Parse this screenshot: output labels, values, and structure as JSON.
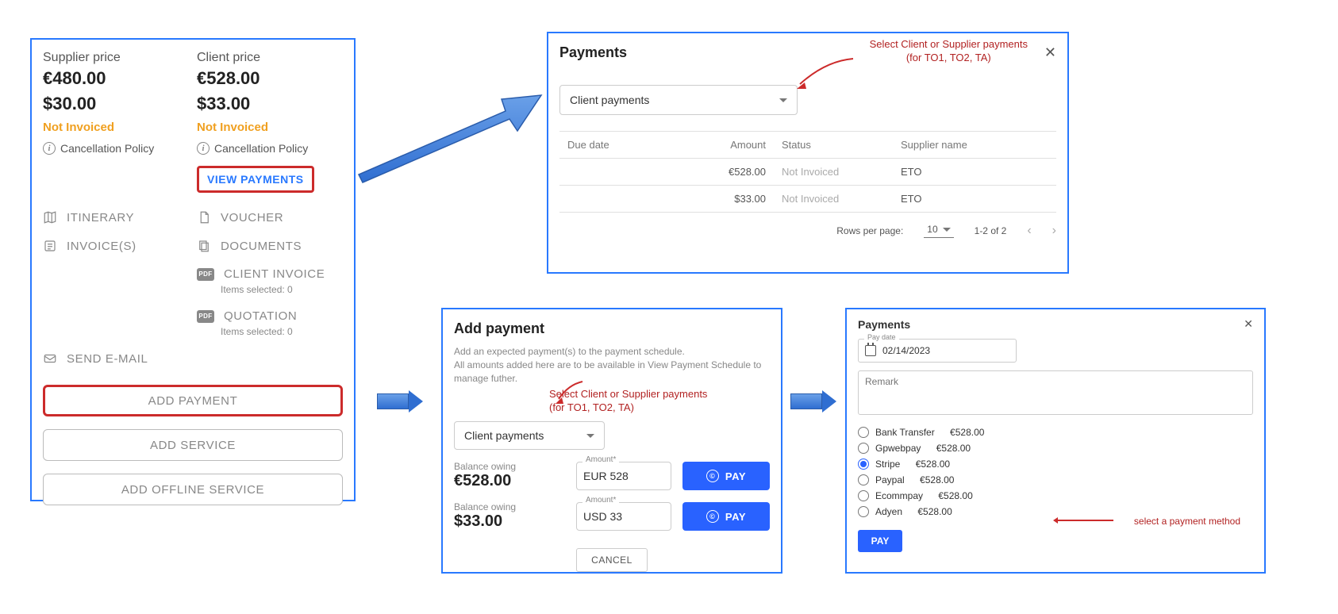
{
  "panel1": {
    "supplier_label": "Supplier price",
    "client_label": "Client price",
    "supplier_price_eur": "€480.00",
    "supplier_price_usd": "$30.00",
    "client_price_eur": "€528.00",
    "client_price_usd": "$33.00",
    "supplier_status": "Not Invoiced",
    "client_status": "Not Invoiced",
    "cancel_policy": "Cancellation Policy",
    "view_payments": "VIEW PAYMENTS",
    "links": {
      "itinerary": "ITINERARY",
      "invoices": "INVOICE(S)",
      "voucher": "VOUCHER",
      "documents": "DOCUMENTS",
      "client_invoice": "CLIENT INVOICE",
      "client_invoice_sub": "Items selected: 0",
      "quotation": "QUOTATION",
      "quotation_sub": "Items selected: 0",
      "send_email": "SEND E-MAIL"
    },
    "add_payment": "ADD PAYMENT",
    "add_service": "ADD SERVICE",
    "add_offline_service": "ADD OFFLINE SERVICE"
  },
  "panel2": {
    "title": "Payments",
    "annotation_l1": "Select Client or Supplier payments",
    "annotation_l2": "(for TO1, TO2, TA)",
    "select_label": "Client payments",
    "head": {
      "due": "Due date",
      "amount": "Amount",
      "status": "Status",
      "supplier": "Supplier name"
    },
    "rows": [
      {
        "due": "",
        "amount": "€528.00",
        "status": "Not Invoiced",
        "supplier": "ETO"
      },
      {
        "due": "",
        "amount": "$33.00",
        "status": "Not Invoiced",
        "supplier": "ETO"
      }
    ],
    "pager": {
      "label": "Rows per page:",
      "size": "10",
      "range": "1-2 of 2"
    }
  },
  "panel3": {
    "title": "Add payment",
    "desc_l1": "Add an expected payment(s) to the payment schedule.",
    "desc_l2": "All amounts added here are to be available in View Payment Schedule to manage futher.",
    "annotation_l1": "Select Client or Supplier payments",
    "annotation_l2": "(for TO1, TO2, TA)",
    "select_label": "Client payments",
    "balance_label": "Balance owing",
    "balance1": "€528.00",
    "balance2": "$33.00",
    "amount_label": "Amount*",
    "amount1": "EUR 528",
    "amount2": "USD 33",
    "pay": "PAY",
    "cancel": "CANCEL"
  },
  "panel4": {
    "title": "Payments",
    "date_label": "Pay date",
    "date_value": "02/14/2023",
    "remark_placeholder": "Remark",
    "options": [
      {
        "name": "Bank Transfer",
        "price": "€528.00",
        "selected": false
      },
      {
        "name": "Gpwebpay",
        "price": "€528.00",
        "selected": false
      },
      {
        "name": "Stripe",
        "price": "€528.00",
        "selected": true
      },
      {
        "name": "Paypal",
        "price": "€528.00",
        "selected": false
      },
      {
        "name": "Ecommpay",
        "price": "€528.00",
        "selected": false
      },
      {
        "name": "Adyen",
        "price": "€528.00",
        "selected": false
      }
    ],
    "annotation": "select a payment method",
    "pay": "PAY"
  }
}
